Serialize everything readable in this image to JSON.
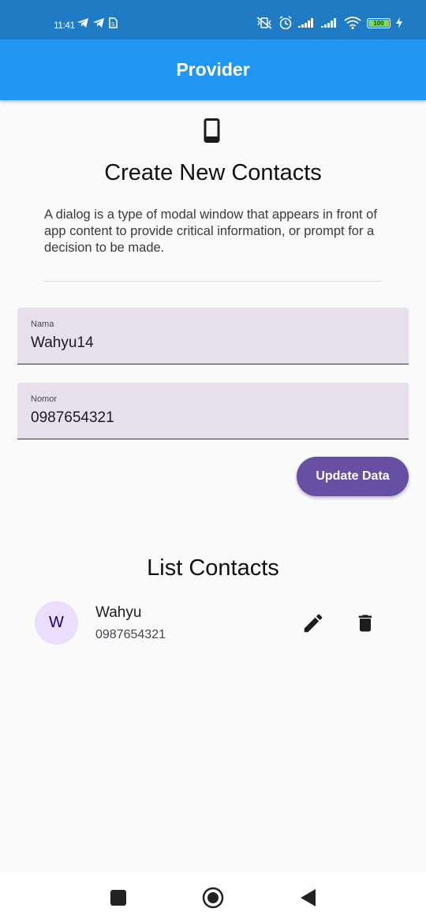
{
  "status_bar": {
    "time": "11:41",
    "battery": "100",
    "icons_left": [
      "telegram-icon",
      "telegram-icon",
      "sim-icon"
    ],
    "icons_right": [
      "vibrate-off-icon",
      "alarm-icon",
      "signal-icon",
      "signal-icon",
      "wifi-icon",
      "battery-icon",
      "charging-icon"
    ]
  },
  "app_bar": {
    "title": "Provider"
  },
  "form": {
    "icon": "phone-icon",
    "title": "Create New Contacts",
    "description": "A dialog is a type of modal window that appears in front of app content to provide critical information, or prompt for a decision to be made.",
    "name_field": {
      "label": "Nama",
      "value": "Wahyu14"
    },
    "number_field": {
      "label": "Nomor",
      "value": "0987654321"
    },
    "submit_label": "Update Data"
  },
  "contacts": {
    "title": "List Contacts",
    "items": [
      {
        "initial": "W",
        "name": "Wahyu",
        "number": "0987654321"
      }
    ]
  },
  "colors": {
    "app_bar": "#2196f3",
    "status_bar": "#1e7bc4",
    "button": "#6750a4",
    "field_bg": "#e7dfec",
    "avatar_bg": "#eaddff"
  },
  "nav_bar": {
    "icons": [
      "recents-icon",
      "home-icon",
      "back-icon"
    ]
  }
}
